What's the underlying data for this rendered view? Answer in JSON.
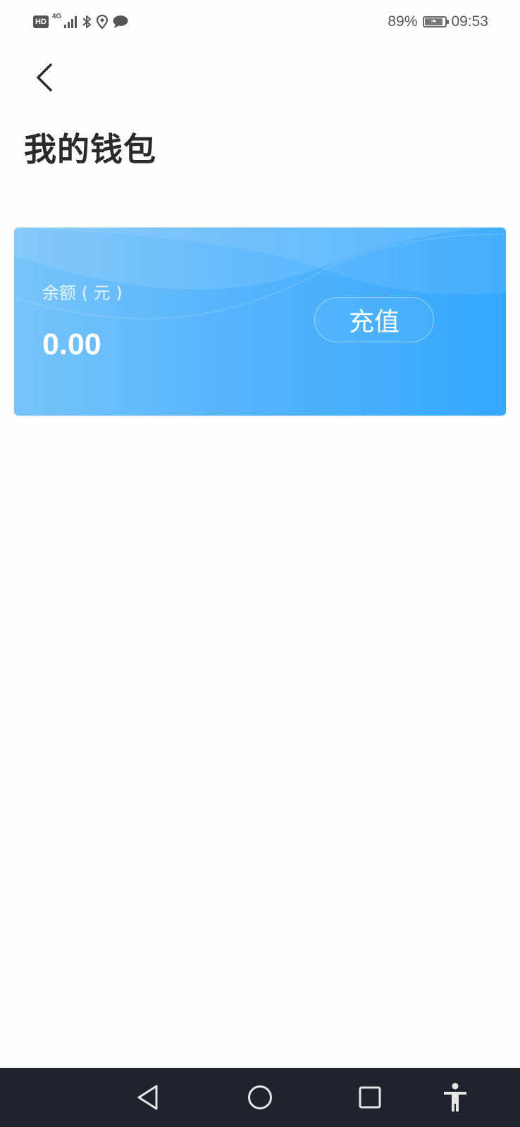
{
  "status_bar": {
    "hd_badge": "HD",
    "network_type": "4G",
    "battery_percent": "89%",
    "battery_level": 0.89,
    "time": "09:53",
    "icons": [
      "hd-icon",
      "signal-icon",
      "bluetooth-icon",
      "location-icon",
      "message-icon",
      "battery-icon"
    ]
  },
  "header": {
    "back_icon": "chevron-left-icon",
    "title": "我的钱包"
  },
  "wallet_card": {
    "balance_label": "余额 ( 元 )",
    "balance_value": "0.00",
    "recharge_label": "充值",
    "colors": {
      "gradient_start": "#77c4fa",
      "gradient_end": "#34a8fd"
    }
  },
  "nav_bar": {
    "background": "#20222c",
    "icons": [
      "back-triangle-icon",
      "home-circle-icon",
      "recents-square-icon",
      "accessibility-icon"
    ]
  }
}
